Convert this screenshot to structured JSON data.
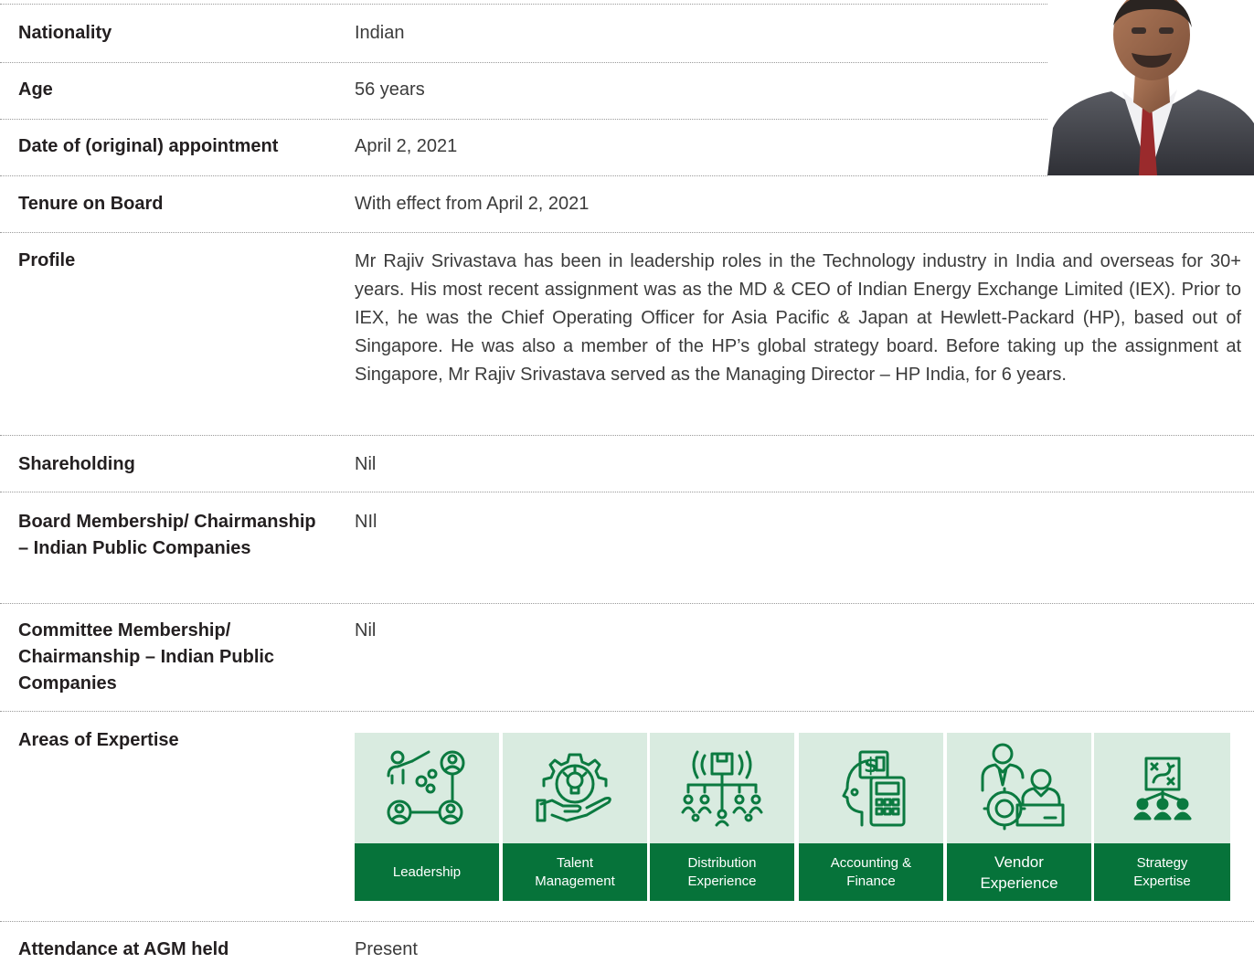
{
  "rows": [
    {
      "label": "Nationality",
      "value": "Indian"
    },
    {
      "label": "Age",
      "value": "56 years"
    },
    {
      "label": "Date of (original) appointment",
      "value": "April 2, 2021"
    },
    {
      "label": "Tenure on Board",
      "value": "With effect from April 2, 2021"
    },
    {
      "label": "Profile",
      "value": "Mr Rajiv Srivastava has been in leadership roles in the Technology industry in India and overseas for 30+ years. His most recent assignment was as the MD & CEO of Indian Energy Exchange Limited (IEX). Prior to IEX, he was the Chief Operating Officer for Asia Pacific & Japan at Hewlett-Packard (HP), based out of Singapore. He was also a member of the HP’s global strategy board. Before taking up the assignment at Singapore, Mr Rajiv Srivastava served as the Managing Director – HP India, for 6 years."
    },
    {
      "label": "Shareholding",
      "value": "Nil"
    },
    {
      "label": "Board Membership/ Chairmanship – Indian Public Companies",
      "value": "NIl"
    },
    {
      "label": "Committee Membership/ Chairmanship – Indian Public Companies",
      "value": "Nil"
    },
    {
      "label": "Areas of Expertise",
      "value": ""
    },
    {
      "label": "Attendance at AGM held",
      "value": "Present"
    }
  ],
  "expertise": [
    {
      "label": "Leadership",
      "icon": "leadership-icon"
    },
    {
      "label": "Talent\nManagement",
      "icon": "talent-management-icon"
    },
    {
      "label": "Distribution\nExperience",
      "icon": "distribution-icon"
    },
    {
      "label": "Accounting &\nFinance",
      "icon": "accounting-finance-icon"
    },
    {
      "label": "Vendor\nExperience",
      "icon": "vendor-icon"
    },
    {
      "label": "Strategy\nExpertise",
      "icon": "strategy-icon"
    }
  ],
  "colors": {
    "tile_bg": "#d9ebe0",
    "caption_bg": "#06733a",
    "icon": "#0b7a40"
  }
}
